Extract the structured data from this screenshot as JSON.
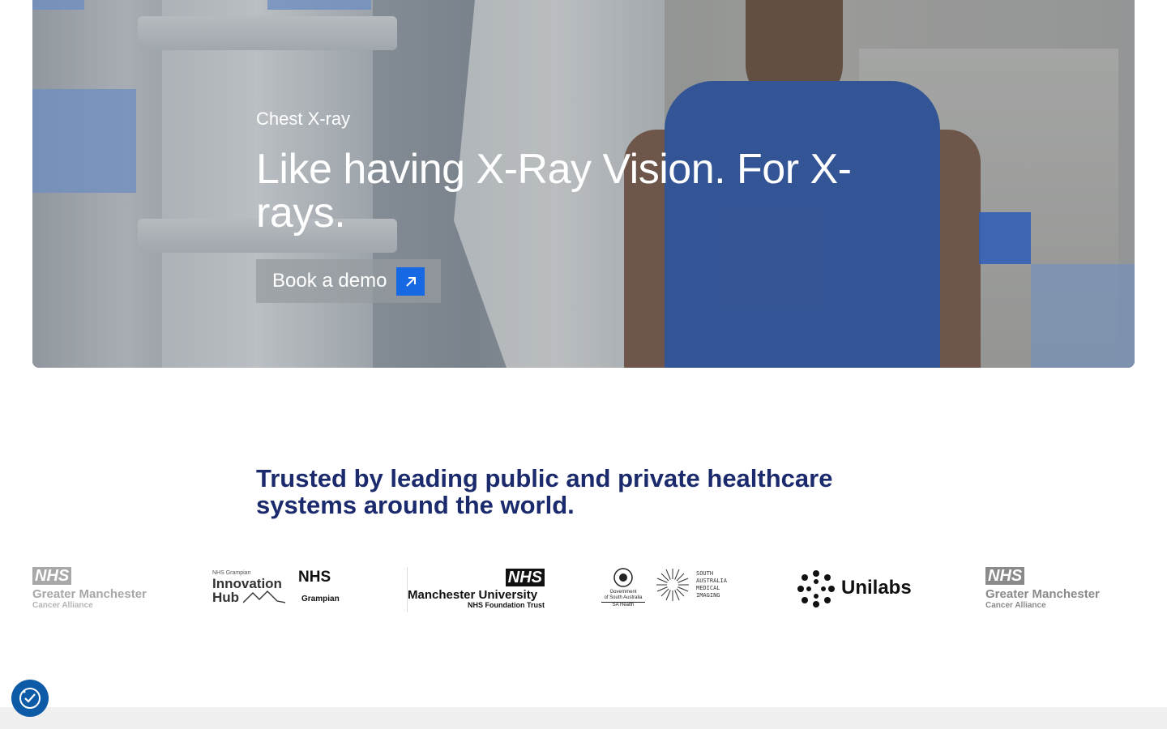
{
  "hero": {
    "eyebrow": "Chest X-ray",
    "title": "Like having X-Ray Vision. For X-rays.",
    "cta_label": "Book a demo"
  },
  "trusted": {
    "heading": "Trusted by leading public and private healthcare systems around the world."
  },
  "logos": [
    {
      "nhs": "NHS",
      "line1": "Greater Manchester",
      "line2": "Cancer Alliance"
    },
    {
      "small": "NHS Grampian",
      "line1": "Innovation",
      "line2": "Hub",
      "nhs": "NHS",
      "sub": "Grampian"
    },
    {
      "nhs": "NHS",
      "line1": "Manchester University",
      "line2": "NHS Foundation Trust"
    },
    {
      "gov1": "Government",
      "gov2": "of South Australia",
      "gov3": "SA Health",
      "sami": "SOUTH AUSTRALIA MEDICAL IMAGING"
    },
    {
      "name": "Unilabs"
    },
    {
      "nhs": "NHS",
      "line1": "Greater Manchester",
      "line2": "Cancer Alliance"
    }
  ],
  "colors": {
    "accent_blue": "#1668e3",
    "heading_navy": "#1a2a6c",
    "cookie_blue": "#0d5aa7"
  },
  "icons": {
    "cta": "arrow-up-right-icon",
    "cookie": "cookie-consent-icon"
  }
}
